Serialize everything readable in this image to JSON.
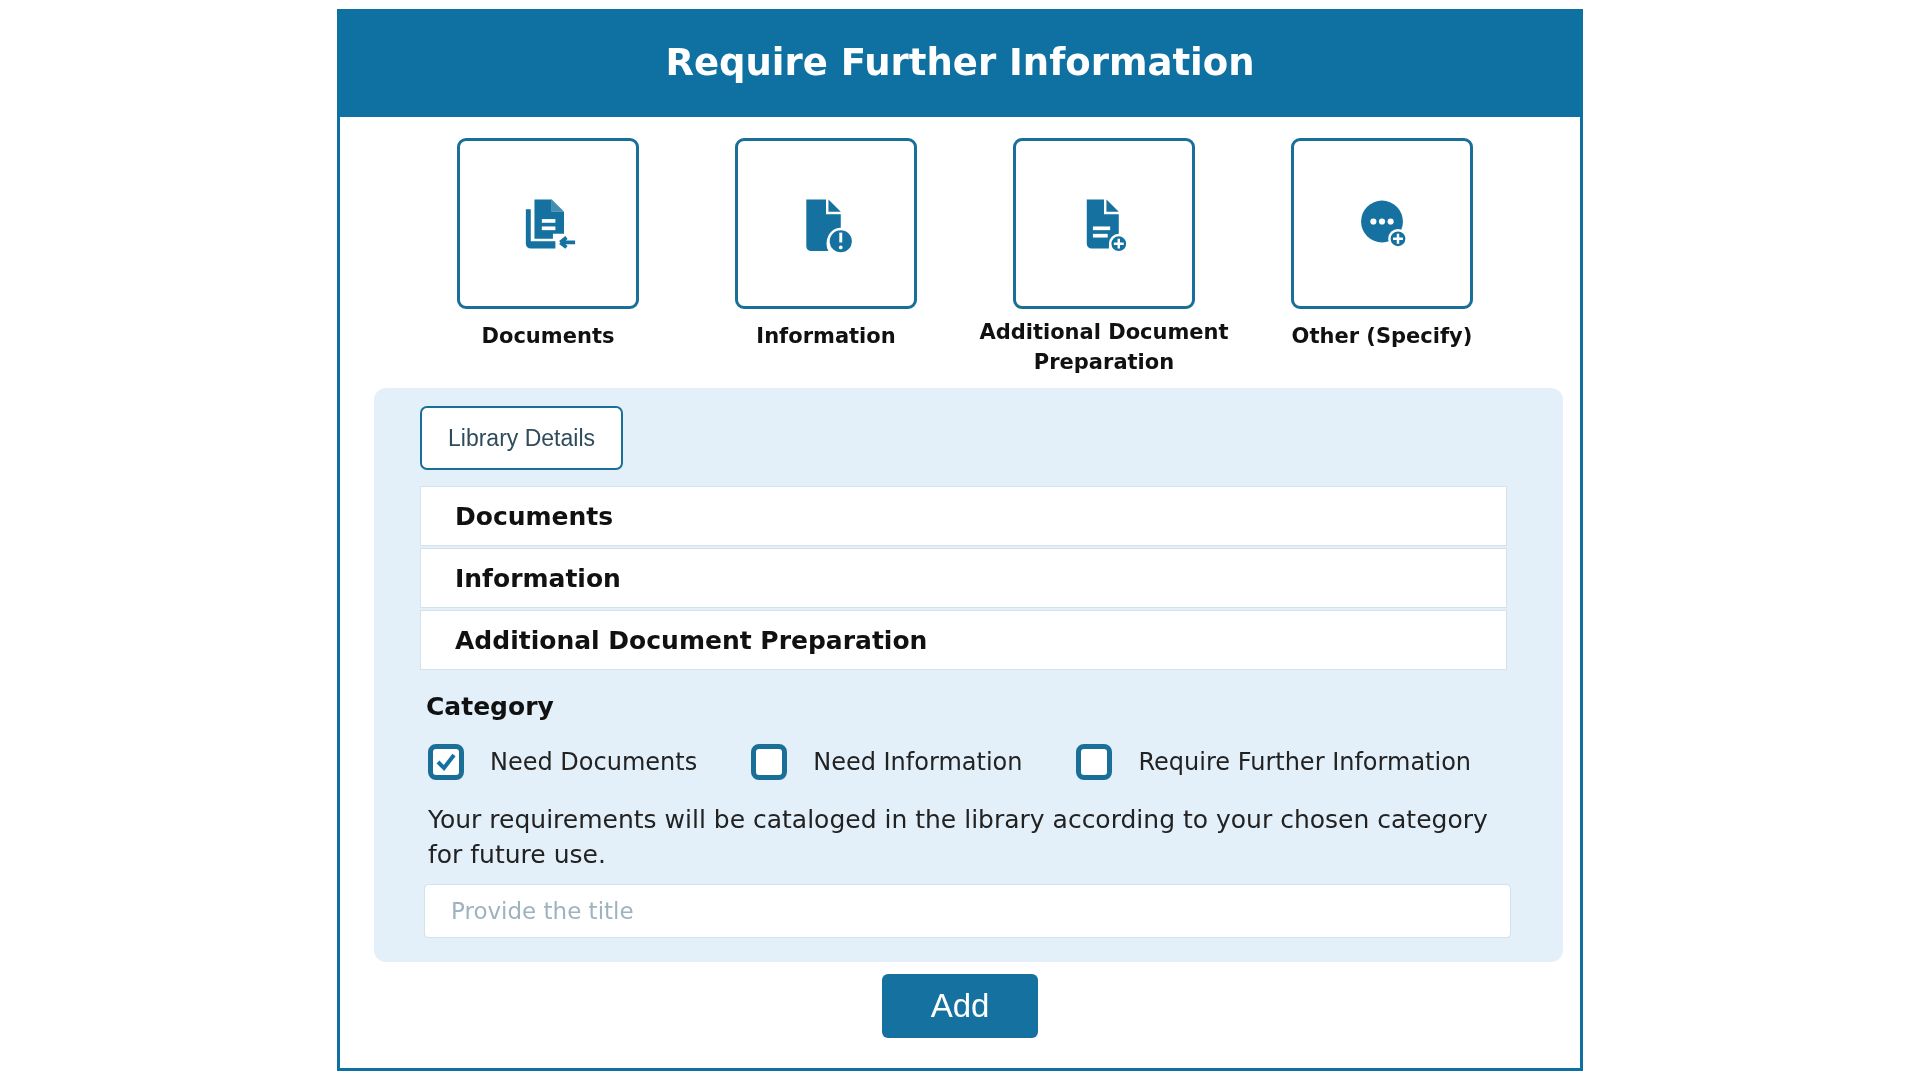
{
  "header": {
    "title": "Require Further Information"
  },
  "tiles": [
    {
      "label": "Documents"
    },
    {
      "label": "Information"
    },
    {
      "label": "Additional Document Preparation"
    },
    {
      "label": "Other (Specify)"
    }
  ],
  "library_button": "Library Details",
  "sections": [
    "Documents",
    "Information",
    "Additional Document Preparation"
  ],
  "category": {
    "heading": "Category",
    "options": [
      {
        "label": "Need Documents",
        "checked": true
      },
      {
        "label": "Need Information",
        "checked": false
      },
      {
        "label": "Require Further Information",
        "checked": false
      }
    ]
  },
  "note": "Your requirements will be cataloged in the library according to your chosen category for future use.",
  "title_field": {
    "placeholder": "Provide the title"
  },
  "add_button": "Add"
}
